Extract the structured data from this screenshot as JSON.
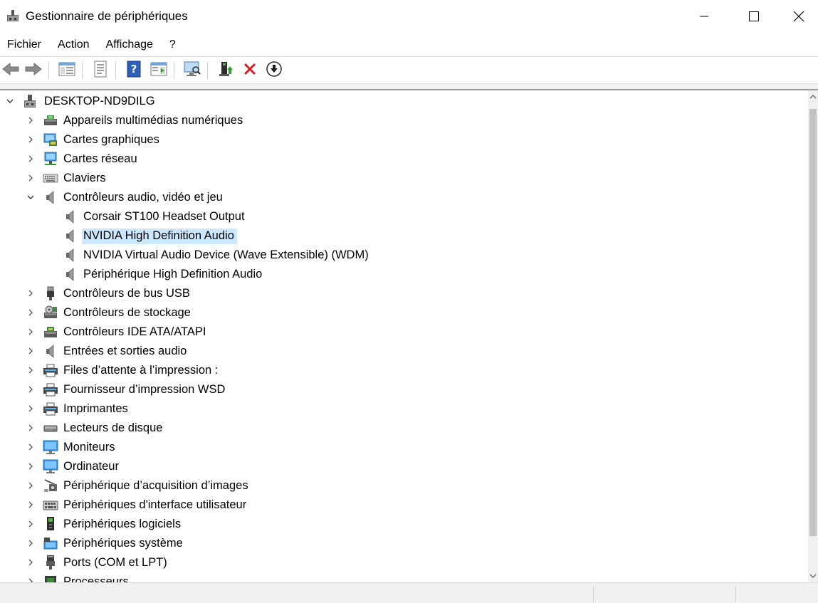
{
  "window": {
    "title": "Gestionnaire de périphériques"
  },
  "menu": [
    {
      "label": "Fichier"
    },
    {
      "label": "Action"
    },
    {
      "label": "Affichage"
    },
    {
      "label": "?"
    }
  ],
  "tree": {
    "root": {
      "label": "DESKTOP-ND9DILG",
      "icon": "computer-tower-icon"
    },
    "items": [
      {
        "label": "Appareils multimédias numériques",
        "icon": "media-device-icon",
        "level": 1,
        "state": "collapsed"
      },
      {
        "label": "Cartes graphiques",
        "icon": "display-adapter-icon",
        "level": 1,
        "state": "collapsed"
      },
      {
        "label": "Cartes réseau",
        "icon": "network-adapter-icon",
        "level": 1,
        "state": "collapsed"
      },
      {
        "label": "Claviers",
        "icon": "keyboard-icon",
        "level": 1,
        "state": "collapsed"
      },
      {
        "label": "Contrôleurs audio, vidéo et jeu",
        "icon": "speaker-icon",
        "level": 1,
        "state": "expanded"
      },
      {
        "label": "Corsair ST100 Headset Output",
        "icon": "speaker-icon",
        "level": 2,
        "state": "leaf"
      },
      {
        "label": "NVIDIA High Definition Audio",
        "icon": "speaker-icon",
        "level": 2,
        "state": "leaf",
        "selected": true
      },
      {
        "label": "NVIDIA Virtual Audio Device (Wave Extensible) (WDM)",
        "icon": "speaker-icon",
        "level": 2,
        "state": "leaf"
      },
      {
        "label": "Périphérique High Definition Audio",
        "icon": "speaker-icon",
        "level": 2,
        "state": "leaf"
      },
      {
        "label": "Contrôleurs de bus USB",
        "icon": "usb-icon",
        "level": 1,
        "state": "collapsed"
      },
      {
        "label": "Contrôleurs de stockage",
        "icon": "storage-controller-icon",
        "level": 1,
        "state": "collapsed"
      },
      {
        "label": "Contrôleurs IDE ATA/ATAPI",
        "icon": "ide-controller-icon",
        "level": 1,
        "state": "collapsed"
      },
      {
        "label": "Entrées et sorties audio",
        "icon": "speaker-icon",
        "level": 1,
        "state": "collapsed"
      },
      {
        "label": "Files d’attente à l’impression :",
        "icon": "printer-icon",
        "level": 1,
        "state": "collapsed"
      },
      {
        "label": "Fournisseur d’impression WSD",
        "icon": "printer-icon",
        "level": 1,
        "state": "collapsed"
      },
      {
        "label": "Imprimantes",
        "icon": "printer-icon",
        "level": 1,
        "state": "collapsed"
      },
      {
        "label": "Lecteurs de disque",
        "icon": "disk-drive-icon",
        "level": 1,
        "state": "collapsed"
      },
      {
        "label": "Moniteurs",
        "icon": "monitor-icon",
        "level": 1,
        "state": "collapsed"
      },
      {
        "label": "Ordinateur",
        "icon": "monitor-icon",
        "level": 1,
        "state": "collapsed"
      },
      {
        "label": "Périphérique d’acquisition d’images",
        "icon": "camera-icon",
        "level": 1,
        "state": "collapsed"
      },
      {
        "label": "Périphériques d'interface utilisateur",
        "icon": "hid-icon",
        "level": 1,
        "state": "collapsed"
      },
      {
        "label": "Périphériques logiciels",
        "icon": "software-device-icon",
        "level": 1,
        "state": "collapsed"
      },
      {
        "label": "Périphériques système",
        "icon": "system-device-icon",
        "level": 1,
        "state": "collapsed"
      },
      {
        "label": "Ports (COM et LPT)",
        "icon": "port-icon",
        "level": 1,
        "state": "collapsed"
      },
      {
        "label": "Processeurs",
        "icon": "processor-icon",
        "level": 1,
        "state": "collapsed"
      }
    ]
  },
  "colors": {
    "selection": "#cce8ff",
    "accent_blue": "#1e7fd6",
    "delete_red": "#e0161c"
  }
}
